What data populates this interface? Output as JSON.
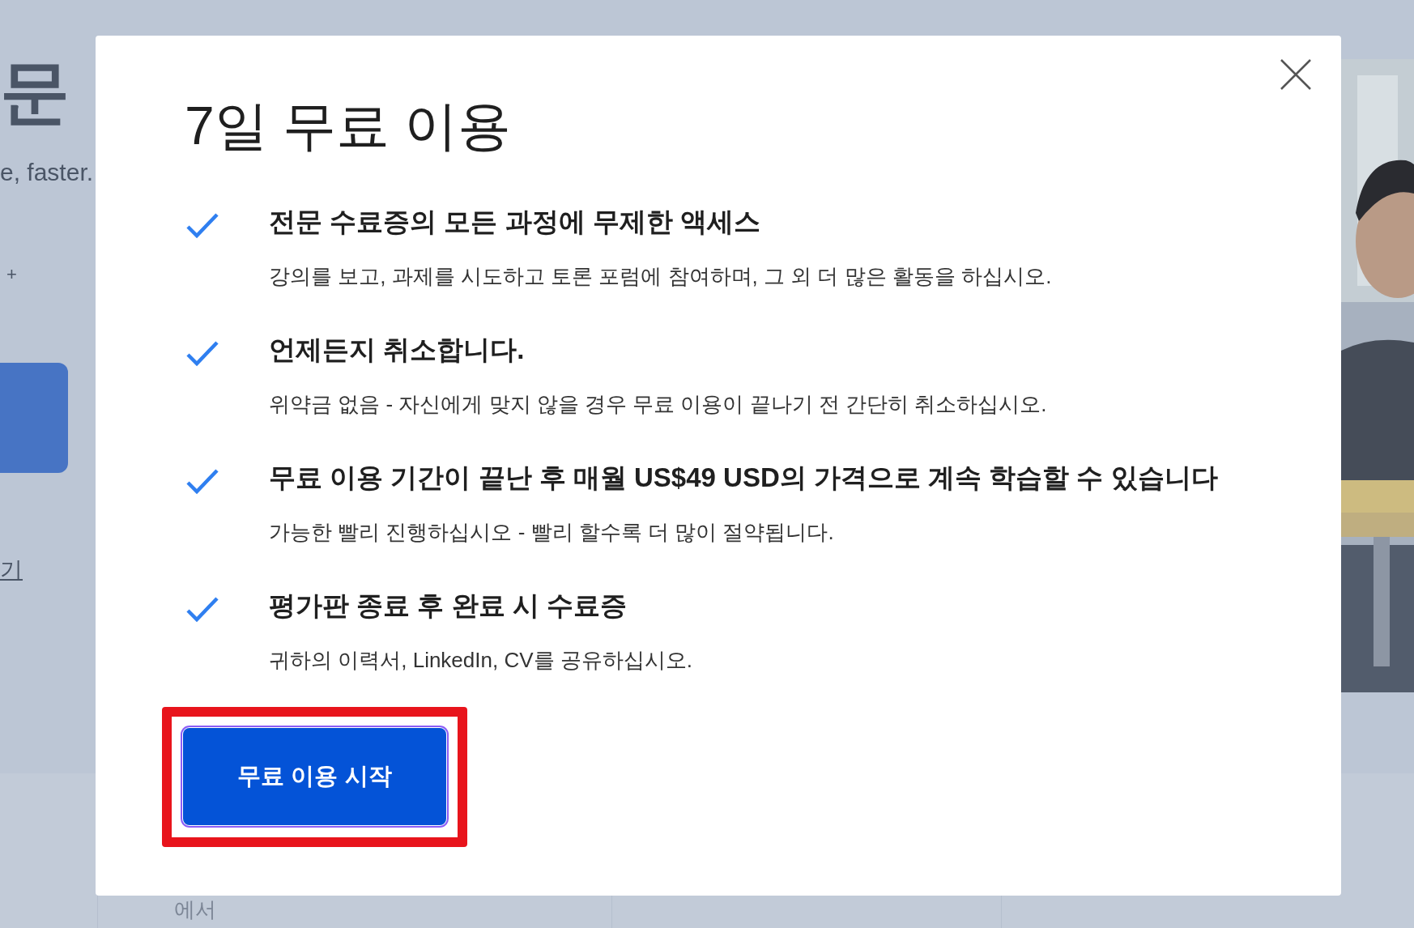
{
  "background_page": {
    "heading_fragment": "문",
    "subtitle_fragment": "e, faster.",
    "plus": "+",
    "link_fragment": "기",
    "footer_fragment": "에서"
  },
  "modal": {
    "title": "7일 무료 이용",
    "features": [
      {
        "checked": true,
        "heading": "전문 수료증의 모든 과정에 무제한 액세스",
        "description": "강의를 보고, 과제를 시도하고 토론 포럼에 참여하며, 그 외 더 많은 활동을 하십시오."
      },
      {
        "checked": true,
        "heading": "언제든지 취소합니다.",
        "description": "위약금 없음 - 자신에게 맞지 않을 경우 무료 이용이 끝나기 전 간단히 취소하십시오."
      },
      {
        "checked": true,
        "heading": "무료 이용 기간이 끝난 후 매월 US$49 USD의 가격으로 계속 학습할 수 있습니다",
        "description": "가능한 빨리 진행하십시오 - 빨리 할수록 더 많이 절약됩니다."
      },
      {
        "checked": true,
        "heading": "평가판 종료 후 완료 시 수료증",
        "description": "귀하의 이력서, LinkedIn, CV를 공유하십시오."
      }
    ],
    "button": {
      "label": "무료 이용 시작",
      "highlighted": true
    }
  }
}
